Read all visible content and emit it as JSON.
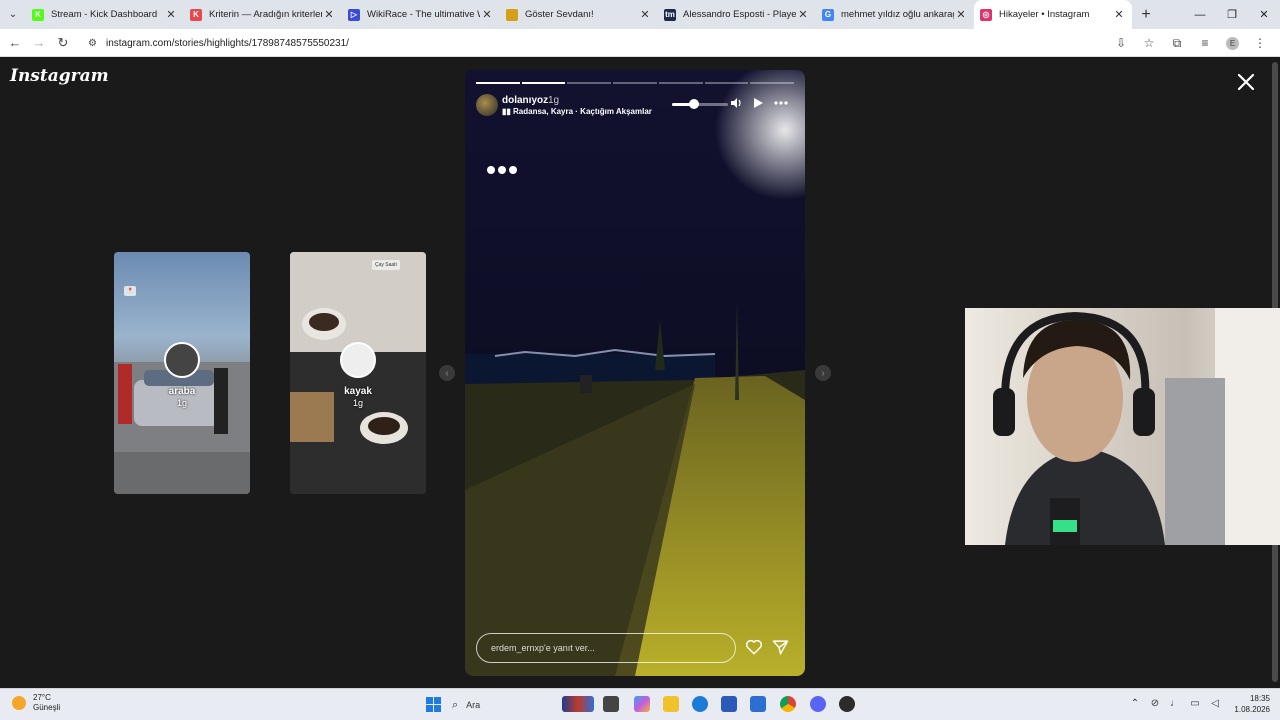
{
  "browser": {
    "tabs": [
      {
        "title": "Stream - Kick Dashboard",
        "favicon_color": "#53fc18",
        "favicon_glyph": "K"
      },
      {
        "title": "Kriterin — Aradığın kriterlere ku",
        "favicon_color": "#e8474d",
        "favicon_glyph": "K"
      },
      {
        "title": "WikiRace - The ultimative Wikip",
        "favicon_color": "#3a4bd8",
        "favicon_glyph": "▷"
      },
      {
        "title": "Göster Sevdanı!",
        "favicon_color": "#d4a017",
        "favicon_glyph": ""
      },
      {
        "title": "Alessandro Esposti - Player pro",
        "favicon_color": "#1b2a4a",
        "favicon_glyph": "tm"
      },
      {
        "title": "mehmet yıldız oğlu ankaragücü",
        "favicon_color": "#4285f4",
        "favicon_glyph": "G"
      },
      {
        "title": "Hikayeler • Instagram",
        "favicon_color": "#e1306c",
        "favicon_glyph": "◎"
      }
    ],
    "url": "instagram.com/stories/highlights/17898748575550231/"
  },
  "instagram": {
    "logo": "Instagram",
    "previews": [
      {
        "title": "araba",
        "age": "1g"
      },
      {
        "title": "kayak",
        "age": "1g",
        "tag": "Çay Saati"
      }
    ],
    "story": {
      "username": "dolanıyoz",
      "age": "1g",
      "music": "Radansa, Kayra · Kaçtığım Akşamlar",
      "progress_segments_total": 7,
      "progress_segments_done": 2,
      "volume_level": 0.4,
      "reply_placeholder": "erdem_ernxp'e yanıt ver..."
    }
  },
  "taskbar": {
    "temperature": "27°C",
    "weather": "Güneşli",
    "search_label": "Ara",
    "time": "18:35",
    "date": "1.08.2026"
  },
  "colors": {
    "background": "#1a1a1a",
    "accent": "#1e7ce0"
  }
}
